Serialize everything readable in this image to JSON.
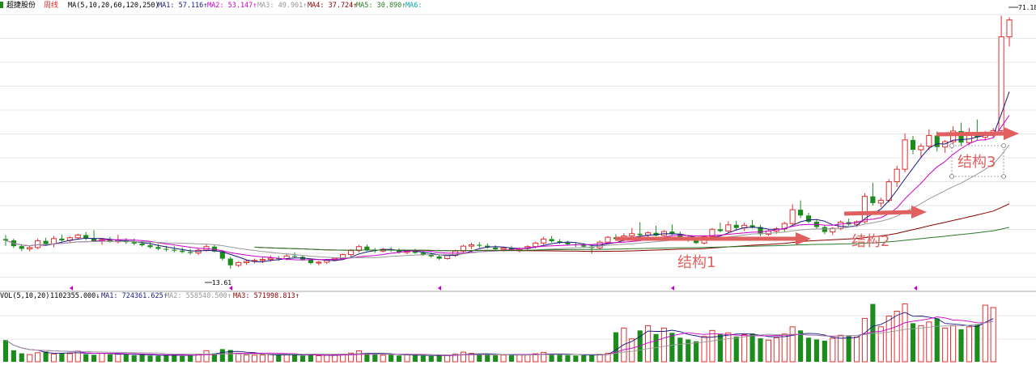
{
  "header": {
    "stock_name": "超捷股份",
    "period_label": "周线",
    "ma_label": "MA(5,10,20,60,120,250)",
    "ma1": "MA1: 57.116↑",
    "ma2": "MA2: 53.147↑",
    "ma3": "MA3: 49.901↑",
    "ma4": "MA4: 37.724↑",
    "ma5": "MA5: 30.890↑",
    "ma6": "MA6:"
  },
  "volume_header": {
    "label": "VOL(5,10,20)",
    "vol": "1102355.000↓",
    "ma1": "MA1: 724361.625↑",
    "ma2": "MA2: 558540.500↑",
    "ma3": "MA3: 571998.813↑"
  },
  "price_labels": {
    "high": "71.18",
    "low": "13.61"
  },
  "annotations": {
    "structure1": "结构1",
    "structure2": "结构2",
    "structure3": "结构3"
  },
  "colors": {
    "up": "#e03030",
    "down": "#1c8c1c",
    "ma1": "#1a1a80",
    "ma2": "#cc00cc",
    "ma3": "#999999",
    "ma4": "#8b0000",
    "ma5": "#2a7a2a",
    "ma6": "#00aaaa",
    "arrow": "#e06060",
    "grid": "#d0d0d0"
  },
  "chart_data": {
    "type": "candlestick",
    "period": "weekly",
    "price_range": [
      13.61,
      71.18
    ],
    "candles": [
      [
        20.9,
        21.8,
        19.4,
        20.6
      ],
      [
        20.6,
        21.0,
        18.9,
        19.3
      ],
      [
        19.3,
        19.8,
        18.2,
        18.7
      ],
      [
        18.7,
        19.5,
        18.1,
        19.0
      ],
      [
        19.0,
        21.0,
        18.6,
        20.5
      ],
      [
        20.5,
        21.2,
        19.4,
        19.8
      ],
      [
        19.8,
        21.6,
        19.1,
        21.0
      ],
      [
        21.0,
        21.9,
        20.3,
        20.6
      ],
      [
        20.6,
        21.5,
        20.1,
        21.2
      ],
      [
        21.2,
        22.1,
        20.7,
        21.8
      ],
      [
        21.8,
        22.5,
        20.6,
        21.0
      ],
      [
        21.0,
        22.9,
        20.2,
        20.4
      ],
      [
        20.4,
        21.1,
        19.6,
        20.8
      ],
      [
        20.8,
        21.4,
        20.1,
        20.3
      ],
      [
        20.3,
        21.9,
        19.9,
        20.6
      ],
      [
        20.6,
        21.1,
        19.8,
        20.2
      ],
      [
        20.2,
        21.0,
        19.5,
        19.9
      ],
      [
        19.9,
        20.5,
        19.2,
        19.5
      ],
      [
        19.5,
        20.2,
        18.8,
        19.1
      ],
      [
        19.1,
        19.8,
        18.4,
        18.7
      ],
      [
        18.7,
        19.4,
        18.1,
        18.5
      ],
      [
        18.5,
        19.3,
        17.9,
        18.3
      ],
      [
        18.3,
        19.0,
        17.7,
        18.0
      ],
      [
        18.0,
        18.7,
        17.4,
        17.8
      ],
      [
        17.8,
        18.8,
        17.3,
        18.4
      ],
      [
        18.4,
        19.8,
        18.0,
        19.2
      ],
      [
        19.2,
        19.6,
        17.9,
        18.1
      ],
      [
        18.1,
        18.4,
        16.1,
        16.5
      ],
      [
        16.5,
        16.9,
        14.2,
        15.0
      ],
      [
        15.0,
        15.9,
        14.6,
        15.6
      ],
      [
        15.6,
        16.2,
        15.1,
        15.9
      ],
      [
        15.9,
        16.5,
        15.4,
        16.1
      ],
      [
        16.1,
        16.8,
        15.5,
        16.3
      ],
      [
        16.3,
        17.2,
        15.8,
        16.6
      ],
      [
        16.6,
        17.1,
        16.0,
        16.4
      ],
      [
        16.4,
        17.5,
        16.1,
        17.1
      ],
      [
        17.1,
        17.9,
        16.6,
        16.9
      ],
      [
        16.9,
        17.2,
        16.0,
        16.3
      ],
      [
        16.3,
        16.6,
        15.2,
        15.5
      ],
      [
        15.5,
        16.0,
        15.0,
        15.7
      ],
      [
        15.7,
        16.4,
        15.3,
        16.2
      ],
      [
        16.2,
        16.8,
        15.9,
        16.6
      ],
      [
        16.6,
        17.6,
        16.4,
        17.4
      ],
      [
        17.4,
        18.6,
        17.0,
        18.3
      ],
      [
        18.3,
        19.6,
        17.9,
        19.2
      ],
      [
        19.2,
        19.7,
        18.2,
        18.5
      ],
      [
        18.5,
        18.9,
        17.8,
        18.2
      ],
      [
        18.2,
        18.9,
        17.9,
        18.6
      ],
      [
        18.6,
        19.1,
        18.0,
        18.4
      ],
      [
        18.4,
        18.8,
        17.6,
        17.9
      ],
      [
        17.9,
        18.5,
        17.5,
        18.2
      ],
      [
        18.2,
        18.7,
        17.6,
        17.8
      ],
      [
        17.8,
        18.3,
        17.1,
        17.4
      ],
      [
        17.4,
        17.9,
        16.7,
        17.0
      ],
      [
        17.0,
        17.3,
        16.2,
        16.5
      ],
      [
        16.5,
        17.4,
        16.3,
        17.2
      ],
      [
        17.2,
        18.5,
        16.9,
        18.2
      ],
      [
        18.2,
        19.6,
        17.9,
        19.3
      ],
      [
        19.3,
        20.1,
        18.6,
        19.6
      ],
      [
        19.6,
        20.2,
        18.9,
        19.4
      ],
      [
        19.4,
        19.9,
        18.7,
        19.0
      ],
      [
        19.0,
        19.5,
        18.3,
        18.6
      ],
      [
        18.6,
        19.2,
        18.1,
        18.9
      ],
      [
        18.9,
        19.4,
        18.3,
        18.5
      ],
      [
        18.5,
        19.0,
        17.9,
        18.8
      ],
      [
        18.8,
        19.5,
        18.4,
        19.2
      ],
      [
        19.2,
        20.3,
        18.8,
        20.0
      ],
      [
        20.0,
        21.4,
        19.6,
        20.9
      ],
      [
        20.9,
        21.6,
        20.1,
        20.4
      ],
      [
        20.4,
        20.9,
        19.8,
        20.1
      ],
      [
        20.1,
        20.5,
        19.4,
        19.7
      ],
      [
        19.7,
        20.2,
        19.1,
        19.5
      ],
      [
        19.5,
        20.0,
        18.9,
        19.2
      ],
      [
        19.2,
        19.7,
        17.6,
        18.9
      ],
      [
        18.9,
        20.6,
        18.6,
        20.2
      ],
      [
        20.2,
        21.6,
        19.8,
        21.3
      ],
      [
        21.3,
        22.0,
        20.6,
        20.9
      ],
      [
        20.9,
        22.2,
        20.3,
        21.6
      ],
      [
        21.6,
        23.4,
        20.8,
        22.1
      ],
      [
        22.1,
        24.7,
        21.4,
        21.8
      ],
      [
        21.8,
        22.6,
        20.9,
        22.3
      ],
      [
        22.3,
        23.9,
        21.5,
        21.7
      ],
      [
        21.7,
        22.9,
        21.2,
        22.6
      ],
      [
        22.6,
        24.2,
        21.8,
        22.0
      ],
      [
        22.0,
        22.6,
        21.1,
        21.4
      ],
      [
        21.4,
        21.8,
        20.3,
        20.6
      ],
      [
        20.6,
        21.2,
        19.8,
        20.0
      ],
      [
        20.0,
        21.8,
        19.7,
        21.5
      ],
      [
        21.5,
        23.4,
        21.0,
        23.1
      ],
      [
        23.1,
        24.6,
        22.4,
        22.7
      ],
      [
        22.7,
        24.9,
        22.2,
        24.1
      ],
      [
        24.1,
        25.0,
        23.0,
        23.4
      ],
      [
        23.4,
        24.6,
        22.7,
        24.0
      ],
      [
        24.0,
        25.2,
        23.3,
        23.6
      ],
      [
        23.6,
        24.1,
        21.6,
        22.0
      ],
      [
        22.0,
        23.2,
        21.6,
        22.7
      ],
      [
        22.7,
        23.6,
        22.1,
        23.2
      ],
      [
        23.2,
        24.8,
        22.6,
        24.4
      ],
      [
        24.4,
        28.7,
        24.0,
        27.5
      ],
      [
        27.5,
        29.6,
        25.6,
        26.2
      ],
      [
        26.2,
        26.8,
        24.4,
        24.8
      ],
      [
        24.8,
        25.3,
        23.2,
        23.6
      ],
      [
        23.6,
        24.1,
        22.0,
        22.5
      ],
      [
        22.5,
        23.6,
        21.8,
        23.3
      ],
      [
        23.3,
        25.1,
        22.9,
        24.7
      ],
      [
        24.7,
        25.5,
        23.9,
        24.2
      ],
      [
        24.2,
        25.1,
        23.6,
        24.8
      ],
      [
        24.8,
        31.2,
        24.4,
        30.5
      ],
      [
        30.5,
        33.6,
        28.4,
        29.0
      ],
      [
        29.0,
        30.2,
        28.1,
        29.6
      ],
      [
        29.6,
        34.4,
        29.1,
        33.8
      ],
      [
        33.8,
        37.4,
        32.6,
        36.6
      ],
      [
        36.6,
        44.7,
        35.9,
        43.2
      ],
      [
        43.2,
        44.1,
        40.0,
        41.0
      ],
      [
        41.0,
        42.4,
        39.1,
        41.8
      ],
      [
        41.8,
        45.6,
        40.9,
        44.2
      ],
      [
        44.2,
        45.1,
        40.6,
        41.6
      ],
      [
        41.6,
        43.2,
        40.3,
        42.8
      ],
      [
        42.8,
        46.3,
        41.9,
        45.2
      ],
      [
        45.2,
        47.1,
        41.8,
        42.6
      ],
      [
        42.6,
        45.9,
        42.1,
        44.9
      ],
      [
        44.9,
        47.8,
        43.2,
        43.8
      ],
      [
        43.8,
        45.2,
        43.0,
        44.6
      ],
      [
        44.6,
        45.9,
        43.7,
        45.3
      ],
      [
        45.3,
        71.18,
        44.9,
        66.4
      ],
      [
        66.4,
        70.8,
        64.2,
        70.2
      ]
    ],
    "volume": [
      180000,
      95000,
      70000,
      60000,
      75000,
      85000,
      65000,
      72000,
      68000,
      88000,
      64000,
      58000,
      70000,
      62000,
      66000,
      60000,
      55000,
      58000,
      52000,
      50000,
      56000,
      61000,
      48000,
      52000,
      63000,
      92000,
      70000,
      105000,
      98000,
      66000,
      58000,
      54000,
      57000,
      60000,
      55000,
      63000,
      58000,
      52000,
      56000,
      50000,
      54000,
      58000,
      61000,
      72000,
      90000,
      68000,
      60000,
      55000,
      58000,
      52000,
      57000,
      54000,
      50000,
      48000,
      52000,
      55000,
      63000,
      80000,
      70000,
      62000,
      58000,
      54000,
      56000,
      53000,
      57000,
      60000,
      66000,
      78000,
      64000,
      58000,
      55000,
      52000,
      54000,
      58000,
      62000,
      70000,
      245000,
      280000,
      190000,
      260000,
      300000,
      230000,
      280000,
      240000,
      200000,
      185000,
      170000,
      210000,
      260000,
      230000,
      240000,
      210000,
      225000,
      235000,
      195000,
      180000,
      200000,
      230000,
      290000,
      260000,
      200000,
      185000,
      175000,
      195000,
      220000,
      215000,
      205000,
      360000,
      480000,
      290000,
      380000,
      420000,
      480000,
      320000,
      300000,
      330000,
      360000,
      280000,
      300000,
      270000,
      290000,
      310000,
      470000,
      450000
    ],
    "ma_series": [
      {
        "name": "MA1",
        "period": 5
      },
      {
        "name": "MA2",
        "period": 10
      },
      {
        "name": "MA3",
        "period": 20
      },
      {
        "name": "MA4",
        "period": 60
      },
      {
        "name": "MA5",
        "period": 120
      }
    ],
    "volume_ma_series": [
      {
        "name": "MA1",
        "period": 5
      },
      {
        "name": "MA2",
        "period": 10
      },
      {
        "name": "MA3",
        "period": 20
      }
    ],
    "annotations": [
      {
        "text": "结构1",
        "type": "arrow-right"
      },
      {
        "text": "结构2",
        "type": "arrow-right"
      },
      {
        "text": "结构3",
        "type": "arrow-right",
        "boxed": true
      }
    ],
    "grid": true
  }
}
